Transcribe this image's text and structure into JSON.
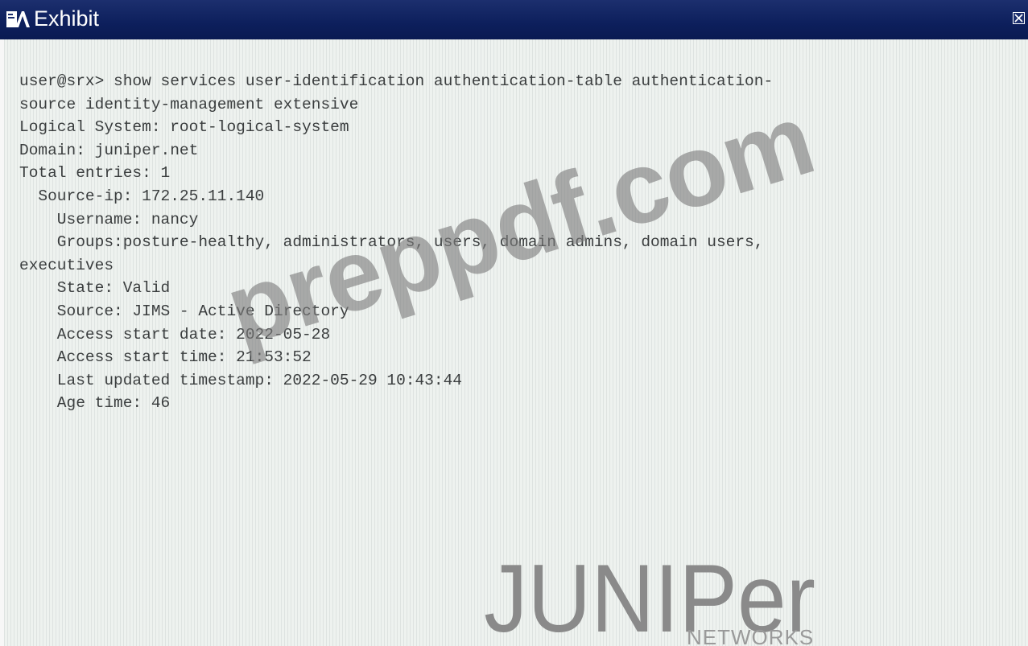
{
  "window": {
    "title": "Exhibit",
    "icon": "exhibit-window-icon",
    "close_icon": "close-icon",
    "title_bar_color": "#0d1f5c"
  },
  "terminal": {
    "lines": [
      "user@srx> show services user-identification authentication-table authentication-",
      "source identity-management extensive",
      "Logical System: root-logical-system",
      "Domain: juniper.net",
      "Total entries: 1",
      "  Source-ip: 172.25.11.140",
      "    Username: nancy",
      "    Groups:posture-healthy, administrators, users, domain admins, domain users,",
      "executives",
      "    State: Valid",
      "    Source: JIMS - Active Directory",
      "    Access start date: 2022-05-28",
      "    Access start time: 21:53:52",
      "    Last updated timestamp: 2022-05-29 10:43:44",
      "    Age time: 46"
    ]
  },
  "watermark": {
    "text": "preppdf.com"
  },
  "logo": {
    "brand": "JUNIPer",
    "subtitle": "NETWORKS"
  }
}
